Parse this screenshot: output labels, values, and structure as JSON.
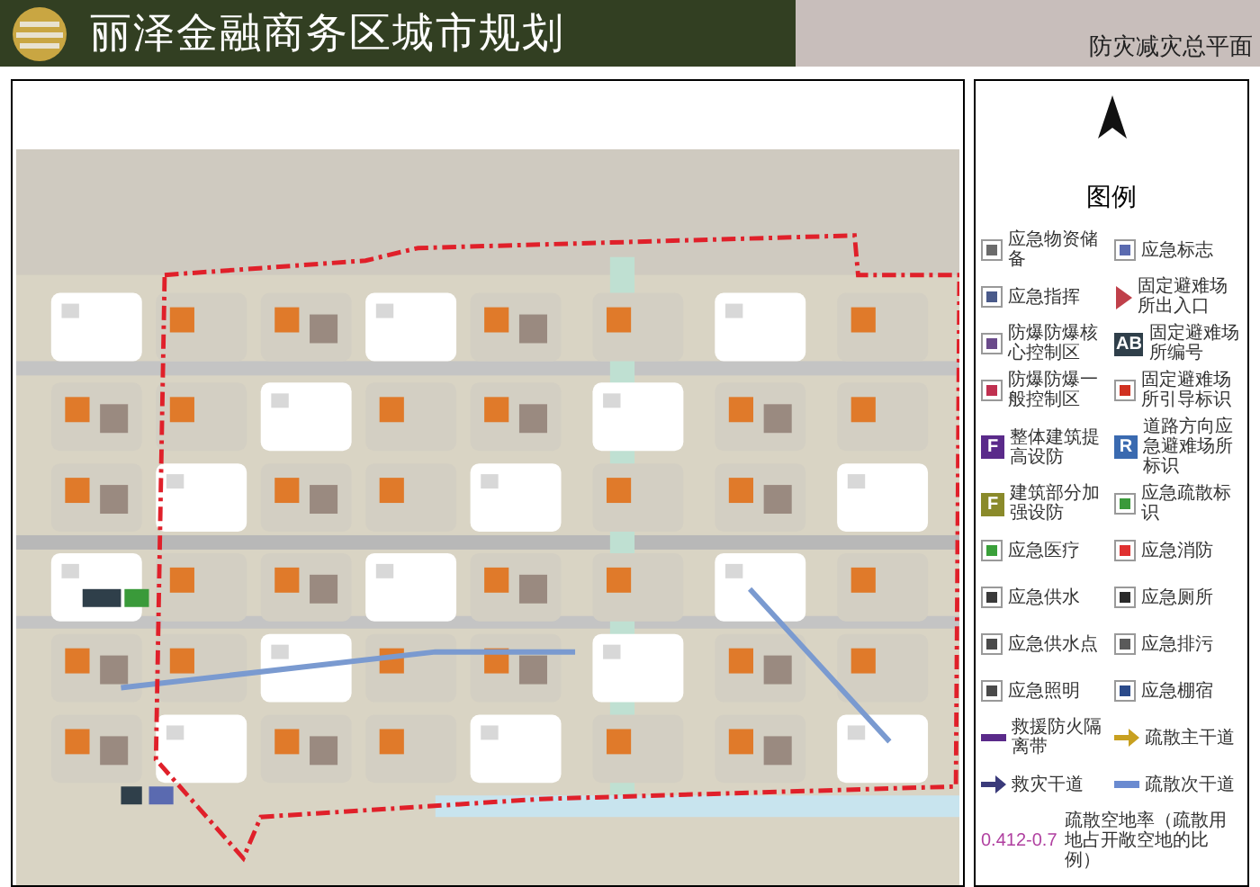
{
  "header": {
    "title": "丽泽金融商务区城市规划",
    "subtitle": "防灾减灾总平面"
  },
  "legend": {
    "title": "图例",
    "items": [
      {
        "kind": "icon",
        "color": "#6b6b6b",
        "label": "应急物资储备"
      },
      {
        "kind": "icon",
        "color": "#5a6ab0",
        "label": "应急标志"
      },
      {
        "kind": "icon",
        "color": "#4a5a8a",
        "label": "应急指挥"
      },
      {
        "kind": "triangle",
        "color": "#c0404a",
        "label": "固定避难场所出入口"
      },
      {
        "kind": "icon",
        "color": "#6a4a8a",
        "label": "防爆防爆核心控制区"
      },
      {
        "kind": "glyph",
        "color": "#2f3f4a",
        "glyph": "AB",
        "label": "固定避难场所编号"
      },
      {
        "kind": "icon",
        "color": "#c03050",
        "label": "防爆防爆一般控制区"
      },
      {
        "kind": "icon",
        "color": "#d03020",
        "label": "固定避难场所引导标识"
      },
      {
        "kind": "glyph",
        "color": "#5a2a8a",
        "glyph": "F",
        "label": "整体建筑提高设防"
      },
      {
        "kind": "glyph",
        "color": "#3a6ab0",
        "glyph": "R",
        "label": "道路方向应急避难场所标识"
      },
      {
        "kind": "glyph",
        "color": "#8a8a2a",
        "glyph": "F",
        "label": "建筑部分加强设防"
      },
      {
        "kind": "icon",
        "color": "#3a9a3a",
        "label": "应急疏散标识"
      },
      {
        "kind": "icon",
        "color": "#3aa03a",
        "label": "应急医疗"
      },
      {
        "kind": "icon",
        "color": "#e03030",
        "label": "应急消防"
      },
      {
        "kind": "icon",
        "color": "#3a3a3a",
        "label": "应急供水"
      },
      {
        "kind": "icon",
        "color": "#2a2a2a",
        "label": "应急厕所"
      },
      {
        "kind": "icon",
        "color": "#4a4a4a",
        "label": "应急供水点"
      },
      {
        "kind": "icon",
        "color": "#5a5a5a",
        "label": "应急排污"
      },
      {
        "kind": "icon",
        "color": "#4a4a4a",
        "label": "应急照明"
      },
      {
        "kind": "icon",
        "color": "#2a4a8a",
        "label": "应急棚宿"
      },
      {
        "kind": "line",
        "color": "#5a2a8a",
        "label": "救援防火隔离带"
      },
      {
        "kind": "arrow",
        "color": "#c8a020",
        "label": "疏散主干道"
      },
      {
        "kind": "arrow",
        "color": "#3a3a7a",
        "label": "救灾干道"
      },
      {
        "kind": "line",
        "color": "#6a8ad0",
        "label": "疏散次干道"
      }
    ],
    "ratio": {
      "value": "0.412-0.7",
      "label": "疏散空地率（疏散用地占开敞空地的比例）"
    }
  }
}
